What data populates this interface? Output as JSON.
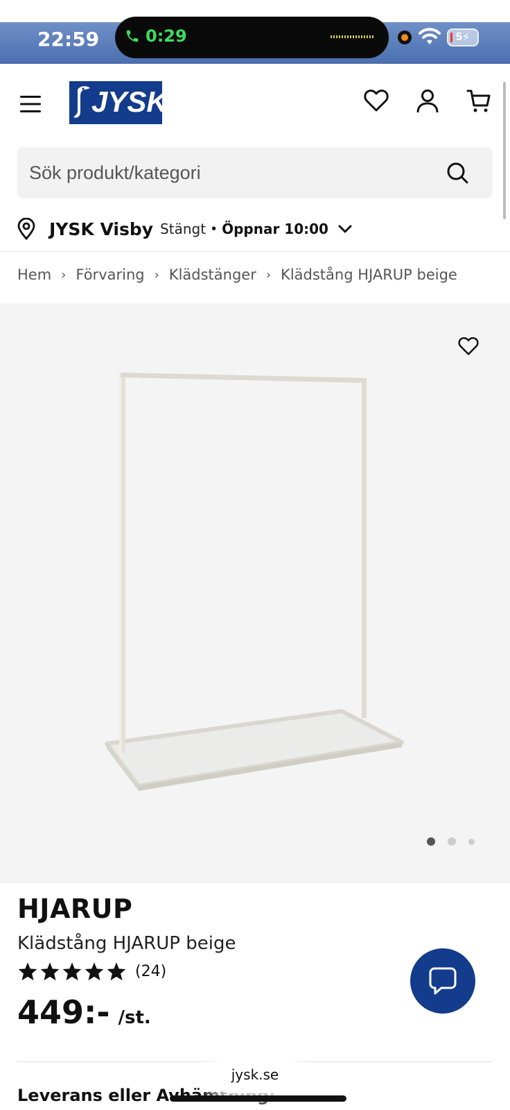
{
  "status_bar": {
    "time": "22:59",
    "call_duration": "0:29",
    "battery": "5"
  },
  "header": {
    "logo_text": "JYSK"
  },
  "search": {
    "placeholder": "Sök produkt/kategori"
  },
  "store": {
    "name": "JYSK Visby",
    "status": "Stängt",
    "separator": "•",
    "opening": "Öppnar 10:00"
  },
  "breadcrumb": [
    "Hem",
    "Förvaring",
    "Klädstänger",
    "Klädstång HJARUP beige"
  ],
  "gallery": {
    "image_count": 3,
    "active_index": 0
  },
  "product": {
    "brand": "HJARUP",
    "name": "Klädstång HJARUP beige",
    "rating_stars": 5,
    "review_count": "(24)",
    "price": "449:-",
    "price_unit": "/st."
  },
  "delivery": {
    "heading": "Leverans eller Avhämtning:"
  },
  "browser": {
    "url": "jysk.se"
  },
  "colors": {
    "brand_blue": "#143c8c",
    "gallery_bg": "#f4f4f4",
    "status_bar_blue": "#5a7dbd",
    "call_green": "#3ddc5f"
  }
}
